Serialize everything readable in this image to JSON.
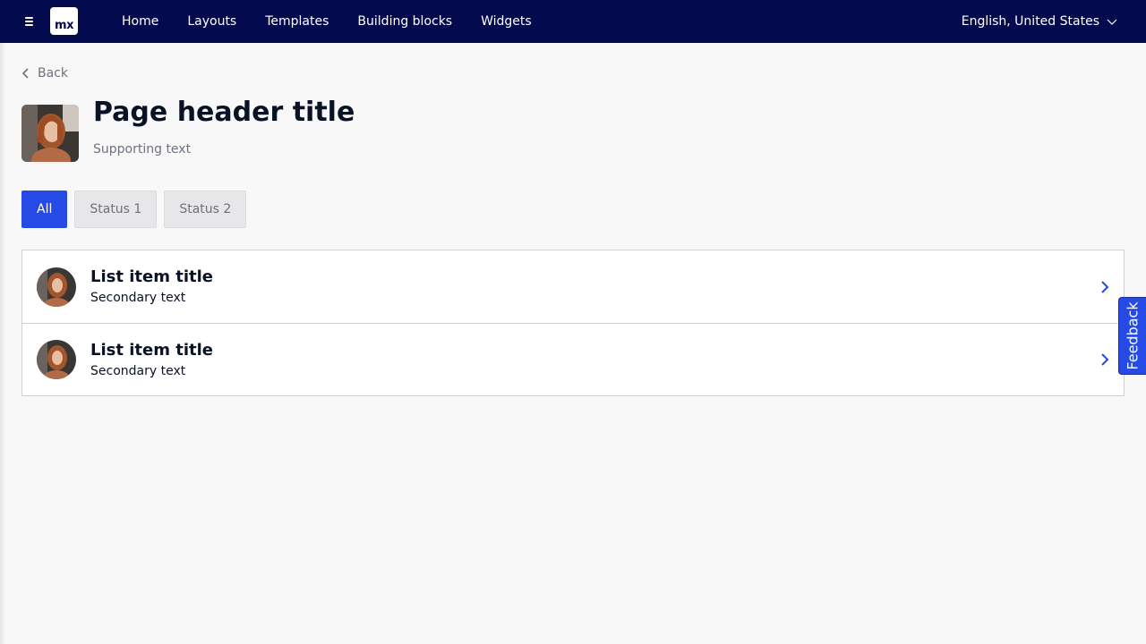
{
  "topbar": {
    "logo_text": "mx",
    "nav": [
      "Home",
      "Layouts",
      "Templates",
      "Building blocks",
      "Widgets"
    ],
    "language": "English, United States",
    "bg_color": "#030b4e"
  },
  "back_label": "Back",
  "header": {
    "title": "Page header title",
    "supporting": "Supporting text"
  },
  "filters": [
    {
      "label": "All",
      "active": true
    },
    {
      "label": "Status 1",
      "active": false
    },
    {
      "label": "Status 2",
      "active": false
    }
  ],
  "list": [
    {
      "title": "List item title",
      "secondary": "Secondary text"
    },
    {
      "title": "List item title",
      "secondary": "Secondary text"
    }
  ],
  "feedback_label": "Feedback",
  "accent_color": "#264ae5"
}
